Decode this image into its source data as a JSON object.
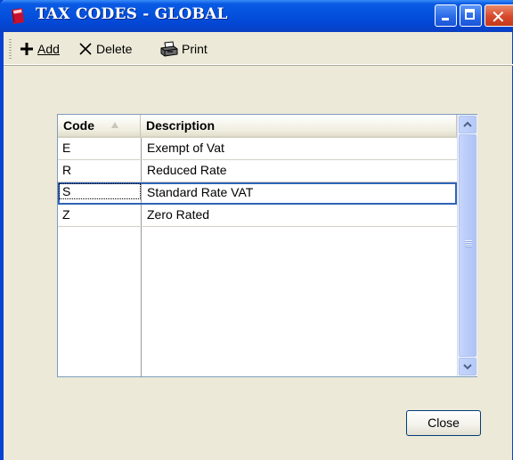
{
  "window": {
    "title": "TAX CODES - GLOBAL"
  },
  "toolbar": {
    "add_label": "Add",
    "delete_label": "Delete",
    "print_label": "Print"
  },
  "grid": {
    "columns": [
      "Code",
      "Description"
    ],
    "sort_column": "Code",
    "sort_direction": "ascending",
    "rows": [
      {
        "code": "E",
        "description": "Exempt of Vat"
      },
      {
        "code": "R",
        "description": "Reduced Rate"
      },
      {
        "code": "S",
        "description": "Standard Rate VAT"
      },
      {
        "code": "Z",
        "description": "Zero Rated"
      }
    ],
    "selected_index": 2
  },
  "footer": {
    "close_label": "Close"
  },
  "colors": {
    "titlebar": "#0453df",
    "window_bg": "#ece9d8",
    "selection_border": "#3063b8",
    "close_button_bg": "#d8482a"
  }
}
